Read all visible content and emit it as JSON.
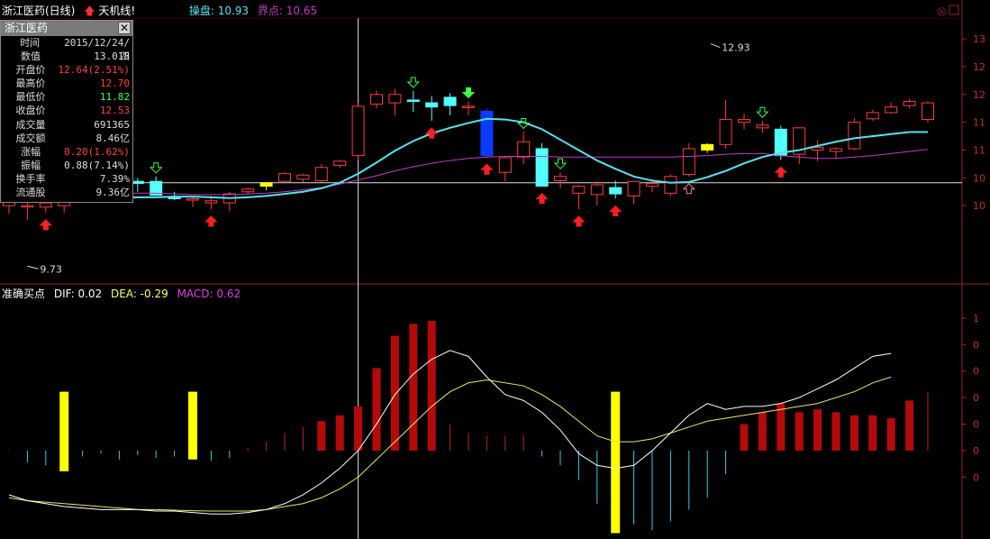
{
  "header": {
    "stock": "浙江医药(日线)",
    "signal": "天机线!",
    "caopan_label": "操盘: 10.93",
    "jiedian_label": "界点: 10.65"
  },
  "info_panel": {
    "title": "浙江医药",
    "close_glyph": "✕",
    "rows": [
      {
        "label": "时间",
        "value": "2015/12/24/四",
        "color": "#dddddd"
      },
      {
        "label": "数值",
        "value": "13.018",
        "color": "#dddddd"
      },
      {
        "label": "开盘价",
        "value": "12.64(2.51%)",
        "color": "#ff4040"
      },
      {
        "label": "最高价",
        "value": "12.70",
        "color": "#ff4040"
      },
      {
        "label": "最低价",
        "value": "11.82",
        "color": "#40ff40"
      },
      {
        "label": "收盘价",
        "value": "12.53",
        "color": "#ff4040"
      },
      {
        "label": "成交量",
        "value": "691365",
        "color": "#dddddd"
      },
      {
        "label": "成交额",
        "value": "8.46亿",
        "color": "#dddddd"
      },
      {
        "label": "涨幅",
        "value": "0.20(1.62%)",
        "color": "#ff4040"
      },
      {
        "label": "振幅",
        "value": "0.88(7.14%)",
        "color": "#dddddd"
      },
      {
        "label": "换手率",
        "value": "7.39%",
        "color": "#dddddd"
      },
      {
        "label": "流通股",
        "value": "9.36亿",
        "color": "#dddddd"
      }
    ]
  },
  "indicator": {
    "name": "准确买点",
    "dif_label": "DIF: 0.02",
    "dea_label": "DEA: -0.29",
    "macd_label": "MACD: 0.62"
  },
  "colors": {
    "up": "#ff3c3c",
    "down": "#54ffff",
    "ma_cyan": "#55e4f0",
    "ma_magenta": "#c33cc3",
    "yellow": "#ffff00",
    "blue": "#0a3cff",
    "axis": "#a02020"
  },
  "chart_data": [
    {
      "type": "candlestick",
      "ylim": [
        9.5,
        13.3
      ],
      "y_tick_labels": [
        "13",
        "12",
        "12",
        "11",
        "11",
        "10",
        "10"
      ],
      "y_ticks": [
        13.0,
        12.6,
        12.2,
        11.8,
        11.4,
        11.0,
        10.6
      ],
      "extreme_labels": {
        "high": "12.93",
        "low": "9.73"
      },
      "candles": [
        {
          "o": 10.6,
          "h": 10.75,
          "l": 10.48,
          "c": 10.8
        },
        {
          "o": 10.6,
          "h": 10.72,
          "l": 10.4,
          "c": 10.6
        },
        {
          "o": 10.58,
          "h": 10.68,
          "l": 10.5,
          "c": 10.64
        },
        {
          "o": 10.6,
          "h": 10.76,
          "l": 10.5,
          "c": 10.72
        },
        {
          "o": 10.76,
          "h": 10.84,
          "l": 10.7,
          "c": 10.82
        },
        {
          "o": 10.72,
          "h": 10.8,
          "l": 10.64,
          "c": 10.76
        },
        {
          "o": 10.76,
          "h": 10.86,
          "l": 10.7,
          "c": 10.82
        },
        {
          "o": 10.95,
          "h": 11.0,
          "l": 10.8,
          "c": 10.92
        },
        {
          "o": 10.95,
          "h": 11.02,
          "l": 10.78,
          "c": 10.75
        },
        {
          "o": 10.72,
          "h": 10.8,
          "l": 10.68,
          "c": 10.7
        },
        {
          "o": 10.68,
          "h": 10.74,
          "l": 10.58,
          "c": 10.7
        },
        {
          "o": 10.64,
          "h": 10.74,
          "l": 10.55,
          "c": 10.67
        },
        {
          "o": 10.64,
          "h": 10.8,
          "l": 10.52,
          "c": 10.77
        },
        {
          "o": 10.8,
          "h": 10.86,
          "l": 10.76,
          "c": 10.84
        },
        {
          "o": 10.88,
          "h": 10.92,
          "l": 10.82,
          "c": 10.93,
          "yellow": true
        },
        {
          "o": 10.95,
          "h": 11.08,
          "l": 10.92,
          "c": 11.06
        },
        {
          "o": 10.98,
          "h": 11.06,
          "l": 10.94,
          "c": 11.04
        },
        {
          "o": 10.96,
          "h": 11.2,
          "l": 10.94,
          "c": 11.15
        },
        {
          "o": 11.18,
          "h": 11.26,
          "l": 11.14,
          "c": 11.24
        },
        {
          "o": 11.32,
          "h": 12.08,
          "l": 11.25,
          "c": 12.03
        },
        {
          "o": 12.06,
          "h": 12.26,
          "l": 12.0,
          "c": 12.2
        },
        {
          "o": 12.08,
          "h": 12.28,
          "l": 11.9,
          "c": 12.2
        },
        {
          "o": 12.12,
          "h": 12.25,
          "l": 11.95,
          "c": 12.1
        },
        {
          "o": 12.08,
          "h": 12.18,
          "l": 11.82,
          "c": 12.02
        },
        {
          "o": 12.16,
          "h": 12.22,
          "l": 11.9,
          "c": 12.04
        },
        {
          "o": 12.03,
          "h": 12.1,
          "l": 11.9,
          "c": 12.03
        },
        {
          "o": 11.96,
          "h": 12.0,
          "l": 11.3,
          "c": 11.32,
          "blue": true
        },
        {
          "o": 11.08,
          "h": 11.3,
          "l": 10.95,
          "c": 11.29
        },
        {
          "o": 11.3,
          "h": 11.66,
          "l": 11.2,
          "c": 11.52
        },
        {
          "o": 11.42,
          "h": 11.5,
          "l": 10.88,
          "c": 10.88
        },
        {
          "o": 10.96,
          "h": 11.08,
          "l": 10.85,
          "c": 11.02
        },
        {
          "o": 10.78,
          "h": 10.9,
          "l": 10.55,
          "c": 10.88
        },
        {
          "o": 10.76,
          "h": 10.95,
          "l": 10.6,
          "c": 10.9
        },
        {
          "o": 10.86,
          "h": 10.96,
          "l": 10.7,
          "c": 10.77
        },
        {
          "o": 10.74,
          "h": 10.96,
          "l": 10.62,
          "c": 10.95
        },
        {
          "o": 10.88,
          "h": 10.98,
          "l": 10.8,
          "c": 10.92
        },
        {
          "o": 10.78,
          "h": 11.05,
          "l": 10.74,
          "c": 11.02
        },
        {
          "o": 11.05,
          "h": 11.5,
          "l": 11.02,
          "c": 11.42
        },
        {
          "o": 11.4,
          "h": 11.5,
          "l": 11.36,
          "c": 11.48,
          "yellow": true
        },
        {
          "o": 11.48,
          "h": 12.12,
          "l": 11.42,
          "c": 11.84
        },
        {
          "o": 11.8,
          "h": 11.92,
          "l": 11.7,
          "c": 11.84
        },
        {
          "o": 11.72,
          "h": 11.82,
          "l": 11.65,
          "c": 11.76
        },
        {
          "o": 11.7,
          "h": 11.75,
          "l": 11.26,
          "c": 11.32
        },
        {
          "o": 11.34,
          "h": 11.72,
          "l": 11.2,
          "c": 11.72
        },
        {
          "o": 11.4,
          "h": 11.54,
          "l": 11.24,
          "c": 11.44
        },
        {
          "o": 11.38,
          "h": 11.44,
          "l": 11.28,
          "c": 11.42
        },
        {
          "o": 11.42,
          "h": 11.86,
          "l": 11.4,
          "c": 11.8
        },
        {
          "o": 11.85,
          "h": 11.98,
          "l": 11.82,
          "c": 11.94
        },
        {
          "o": 11.94,
          "h": 12.08,
          "l": 11.92,
          "c": 12.02
        },
        {
          "o": 12.04,
          "h": 12.14,
          "l": 12.0,
          "c": 12.1
        },
        {
          "o": 11.84,
          "h": 12.1,
          "l": 11.8,
          "c": 12.08
        }
      ],
      "ma_cyan": [
        10.66,
        10.66,
        10.66,
        10.67,
        10.69,
        10.7,
        10.71,
        10.72,
        10.72,
        10.73,
        10.73,
        10.72,
        10.71,
        10.72,
        10.74,
        10.77,
        10.8,
        10.85,
        10.93,
        11.06,
        11.22,
        11.39,
        11.53,
        11.64,
        11.72,
        11.79,
        11.85,
        11.84,
        11.8,
        11.7,
        11.55,
        11.4,
        11.25,
        11.13,
        11.02,
        10.96,
        10.93,
        10.94,
        11.01,
        11.1,
        11.21,
        11.3,
        11.36,
        11.4,
        11.46,
        11.52,
        11.57,
        11.6,
        11.63,
        11.66,
        11.66
      ],
      "ma_magenta": [
        10.82,
        10.8,
        10.79,
        10.79,
        10.79,
        10.78,
        10.78,
        10.78,
        10.78,
        10.77,
        10.76,
        10.76,
        10.76,
        10.77,
        10.78,
        10.8,
        10.83,
        10.86,
        10.91,
        10.97,
        11.03,
        11.1,
        11.16,
        11.21,
        11.25,
        11.28,
        11.3,
        11.31,
        11.31,
        11.31,
        11.3,
        11.3,
        11.3,
        11.3,
        11.3,
        11.3,
        11.3,
        11.31,
        11.32,
        11.34,
        11.35,
        11.35,
        11.32,
        11.3,
        11.28,
        11.28,
        11.3,
        11.32,
        11.35,
        11.38,
        11.41
      ],
      "ref_line": 10.93,
      "buy_arrows": [
        2,
        11,
        23,
        26,
        29,
        31,
        33,
        42
      ],
      "sell_arrows": [
        8,
        22,
        28,
        30,
        41
      ],
      "hollow_up_arrows": [
        37
      ],
      "green_down_arrow": [
        25
      ]
    },
    {
      "type": "macd",
      "ylim": [
        -3.0,
        5.2
      ],
      "y_ticks": [
        4.5,
        3.6,
        2.7,
        1.8,
        0.9,
        0.0,
        -0.9
      ],
      "y_tick_labels": [
        "1",
        "0",
        "0",
        "0",
        "0",
        "0",
        "0"
      ],
      "macd_bars": [
        0.02,
        -0.4,
        -0.5,
        -0.3,
        -0.2,
        -0.1,
        -0.3,
        -0.15,
        -0.25,
        -0.2,
        -0.3,
        -0.35,
        -0.25,
        0.1,
        0.3,
        0.6,
        0.8,
        1.0,
        1.2,
        1.5,
        2.8,
        3.9,
        4.3,
        4.4,
        0.9,
        0.6,
        0.5,
        0.5,
        0.5,
        -0.2,
        -0.5,
        -1.0,
        -1.8,
        -2.2,
        -2.5,
        -2.7,
        -2.4,
        -2.0,
        -1.6,
        -0.8,
        0.9,
        1.3,
        1.6,
        1.3,
        1.4,
        1.3,
        1.2,
        1.2,
        1.1,
        1.7,
        2.0
      ],
      "dif": [
        -1.5,
        -1.7,
        -1.8,
        -1.9,
        -1.95,
        -2.0,
        -2.0,
        -2.0,
        -2.05,
        -2.05,
        -2.1,
        -2.15,
        -2.15,
        -2.1,
        -2.0,
        -1.8,
        -1.5,
        -1.1,
        -0.6,
        0.0,
        0.9,
        1.9,
        2.6,
        3.1,
        3.4,
        3.2,
        2.5,
        1.9,
        1.7,
        1.3,
        0.7,
        -0.1,
        -0.5,
        -0.6,
        -0.5,
        0.0,
        0.6,
        1.2,
        1.6,
        1.4,
        1.5,
        1.5,
        1.6,
        1.8,
        2.1,
        2.4,
        2.8,
        3.2,
        3.3
      ],
      "dea": [
        -1.6,
        -1.7,
        -1.75,
        -1.8,
        -1.85,
        -1.9,
        -1.95,
        -2.0,
        -2.0,
        -2.02,
        -2.04,
        -2.05,
        -2.05,
        -2.05,
        -2.0,
        -1.9,
        -1.8,
        -1.6,
        -1.3,
        -0.9,
        -0.3,
        0.3,
        0.9,
        1.5,
        2.0,
        2.3,
        2.4,
        2.3,
        2.2,
        1.9,
        1.5,
        1.0,
        0.5,
        0.3,
        0.3,
        0.4,
        0.6,
        0.8,
        1.0,
        1.1,
        1.2,
        1.3,
        1.4,
        1.5,
        1.6,
        1.8,
        2.0,
        2.3,
        2.5
      ],
      "yellow_bars": [
        {
          "i": 3,
          "top": 2.0,
          "bottom": -0.7
        },
        {
          "i": 10,
          "top": 2.0,
          "bottom": -0.3
        },
        {
          "i": 33,
          "top": 2.0,
          "bottom": -2.8
        }
      ]
    }
  ]
}
